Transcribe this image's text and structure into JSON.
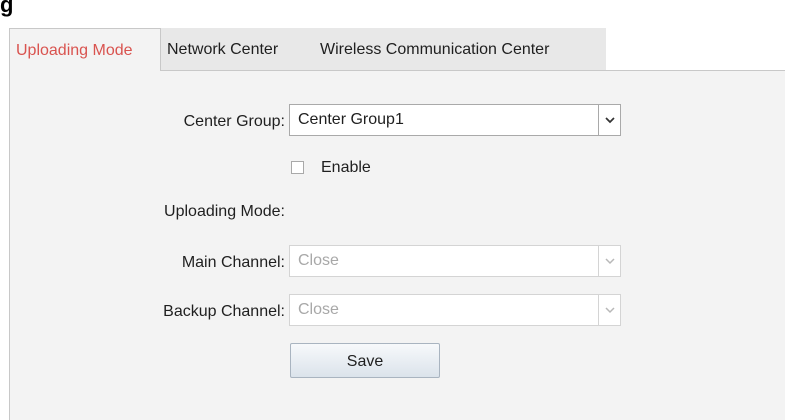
{
  "tabs": [
    {
      "label": "Uploading Mode",
      "active": true
    },
    {
      "label": "Network Center",
      "active": false
    },
    {
      "label": "Wireless Communication Center",
      "active": false
    }
  ],
  "form": {
    "center_group_label": "Center Group:",
    "center_group_value": "Center Group1",
    "enable_label": "Enable",
    "enable_checked": false,
    "uploading_mode_label": "Uploading Mode:",
    "main_channel_label": "Main Channel:",
    "main_channel_value": "Close",
    "backup_channel_label": "Backup Channel:",
    "backup_channel_value": "Close",
    "save_label": "Save"
  },
  "icons": {
    "select_arrow": "chevron-down-icon"
  },
  "colors": {
    "active_tab_text": "#d9534f",
    "panel_bg": "#f3f3f3",
    "disabled_text": "#a8a8a8"
  }
}
